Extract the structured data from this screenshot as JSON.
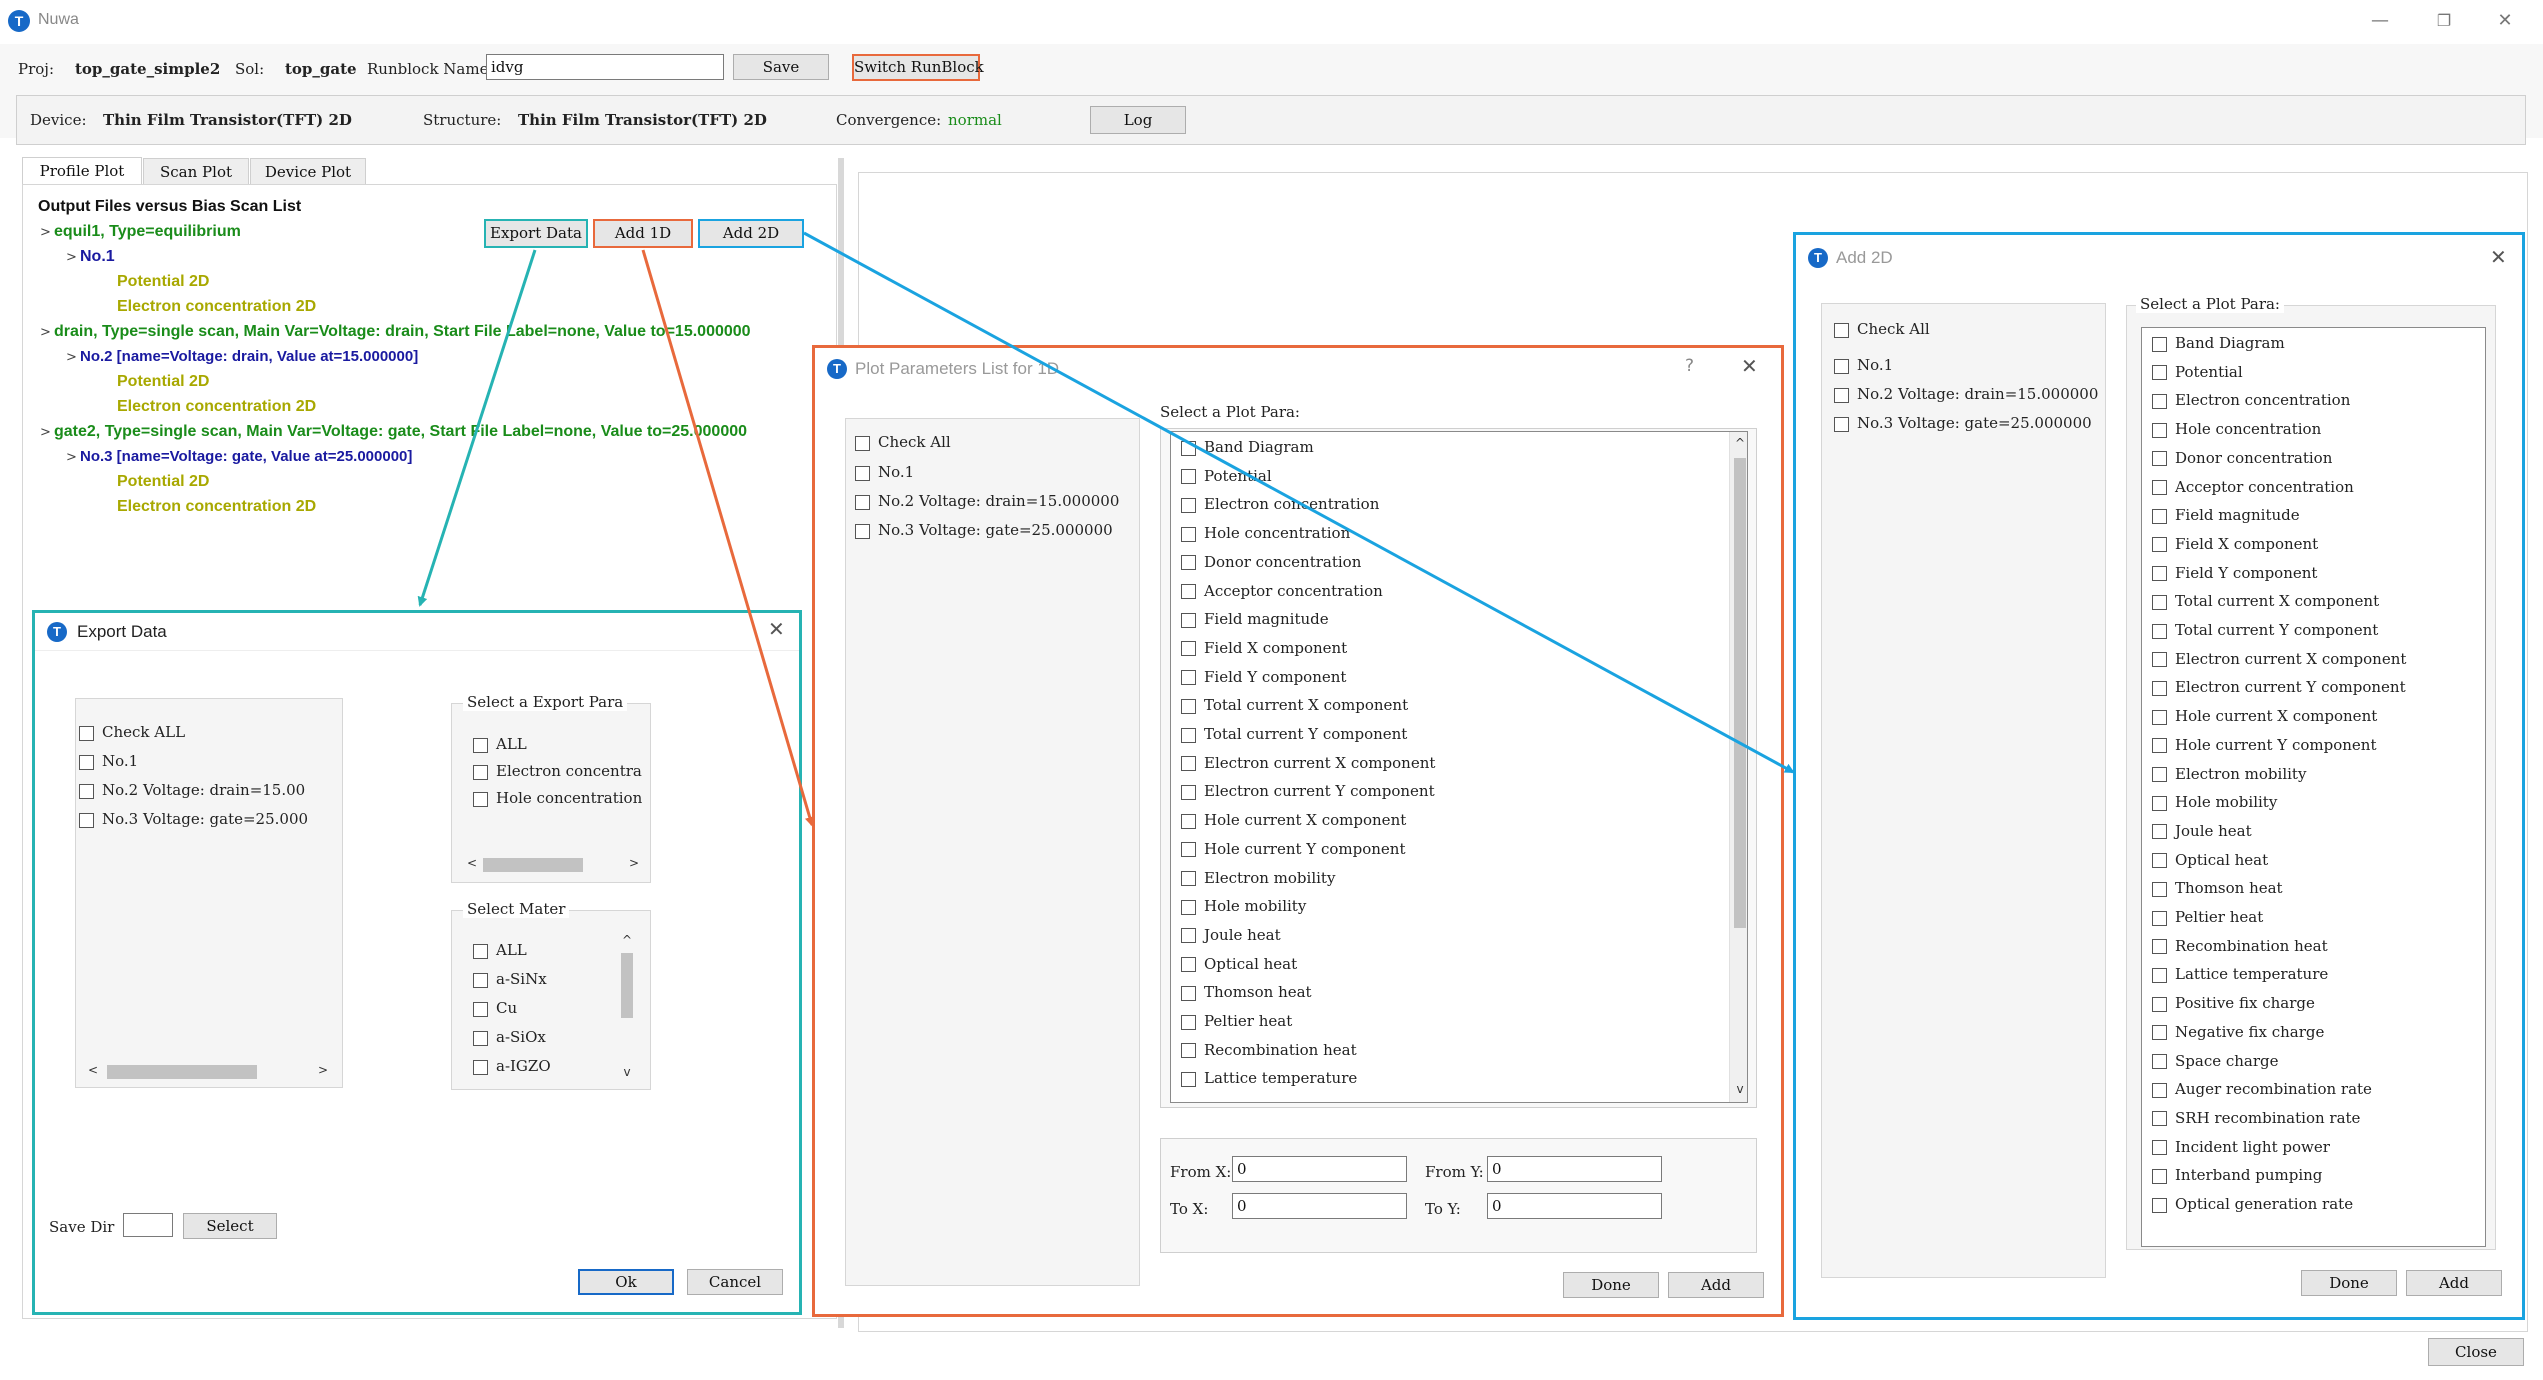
{
  "window": {
    "title": "Nuwa",
    "minimize": "—",
    "restore": "❐",
    "close": "✕"
  },
  "toolbar": {
    "proj_label": "Proj:",
    "proj_value": "top_gate_simple2",
    "sol_label": "Sol:",
    "sol_value": "top_gate",
    "runblock_label": "Runblock Name:",
    "runblock_value": "idvg",
    "save_label": "Save",
    "switch_label": "Switch RunBlock"
  },
  "info": {
    "device_label": "Device:",
    "device_value": "Thin Film Transistor(TFT) 2D",
    "structure_label": "Structure:",
    "structure_value": "Thin Film Transistor(TFT) 2D",
    "convergence_label": "Convergence:",
    "convergence_value": "normal",
    "log_label": "Log"
  },
  "tabs": [
    "Profile Plot",
    "Scan Plot",
    "Device Plot"
  ],
  "tree": {
    "header": "Output Files versus Bias Scan List",
    "export_label": "Export Data",
    "add1d_label": "Add 1D",
    "add2d_label": "Add 2D",
    "items": [
      "equil1, Type=equilibrium",
      "No.1",
      "Potential 2D",
      "Electron concentration 2D",
      "drain, Type=single scan, Main Var=Voltage: drain, Start File Label=none, Value to=15.000000",
      "No.2  [name=Voltage: drain, Value at=15.000000]",
      "Potential 2D",
      "Electron concentration 2D",
      "gate2, Type=single scan, Main Var=Voltage: gate, Start File Label=none, Value to=25.000000",
      "No.3  [name=Voltage: gate, Value at=25.000000]",
      "Potential 2D",
      "Electron concentration 2D"
    ]
  },
  "export_dialog": {
    "title": "Export Data",
    "files": [
      "Check ALL",
      "No.1",
      "No.2 Voltage: drain=15.00",
      "No.3 Voltage: gate=25.000"
    ],
    "para_title": "Select a Export Para",
    "paras": [
      "ALL",
      "Electron concentra",
      "Hole concentration"
    ],
    "mater_title": "Select Mater",
    "maters": [
      "ALL",
      "a-SiNx",
      "Cu",
      "a-SiOx",
      "a-IGZO"
    ],
    "save_dir_label": "Save Dir",
    "select_label": "Select",
    "ok_label": "Ok",
    "cancel_label": "Cancel"
  },
  "plot1d_dialog": {
    "title": "Plot Parameters List for 1D",
    "help": "?",
    "files": [
      "Check All",
      "No.1",
      "No.2 Voltage: drain=15.000000",
      "No.3 Voltage: gate=25.000000"
    ],
    "para_title": "Select a Plot Para:",
    "paras": [
      "Band Diagram",
      "Potential",
      "Electron concentration",
      "Hole concentration",
      "Donor concentration",
      "Acceptor concentration",
      "Field magnitude",
      "Field X component",
      "Field Y component",
      "Total current X component",
      "Total current Y component",
      "Electron current X component",
      "Electron current Y component",
      "Hole current X component",
      "Hole current Y component",
      "Electron mobility",
      "Hole mobility",
      "Joule heat",
      "Optical heat",
      "Thomson heat",
      "Peltier heat",
      "Recombination heat",
      "Lattice temperature"
    ],
    "from_x_label": "From X:",
    "from_x_value": "0",
    "from_y_label": "From Y:",
    "from_y_value": "0",
    "to_x_label": "To X:",
    "to_x_value": "0",
    "to_y_label": "To Y:",
    "to_y_value": "0",
    "done_label": "Done",
    "add_label": "Add"
  },
  "add2d_dialog": {
    "title": "Add 2D",
    "files": [
      "Check All",
      "No.1",
      "No.2 Voltage: drain=15.000000",
      "No.3 Voltage: gate=25.000000"
    ],
    "para_title": "Select a Plot Para:",
    "paras": [
      "Band Diagram",
      "Potential",
      "Electron concentration",
      "Hole concentration",
      "Donor concentration",
      "Acceptor concentration",
      "Field magnitude",
      "Field X component",
      "Field Y component",
      "Total current X component",
      "Total current Y component",
      "Electron current X component",
      "Electron current Y component",
      "Hole current X component",
      "Hole current Y component",
      "Electron mobility",
      "Hole mobility",
      "Joule heat",
      "Optical heat",
      "Thomson heat",
      "Peltier heat",
      "Recombination heat",
      "Lattice temperature",
      "Positive fix charge",
      "Negative fix charge",
      "Space charge",
      "Auger recombination rate",
      "SRH recombination rate",
      "Incident light power",
      "Interband pumping",
      "Optical generation rate"
    ],
    "done_label": "Done",
    "add_label": "Add"
  },
  "footer": {
    "close_label": "Close"
  },
  "colors": {
    "teal": "#26b3b3",
    "orange": "#e8693c",
    "blue": "#1aa3e0",
    "green_text": "#1a8c1a",
    "navy_text": "#1a1aa0",
    "olive_text": "#a8a800",
    "brand": "#1769c7"
  }
}
